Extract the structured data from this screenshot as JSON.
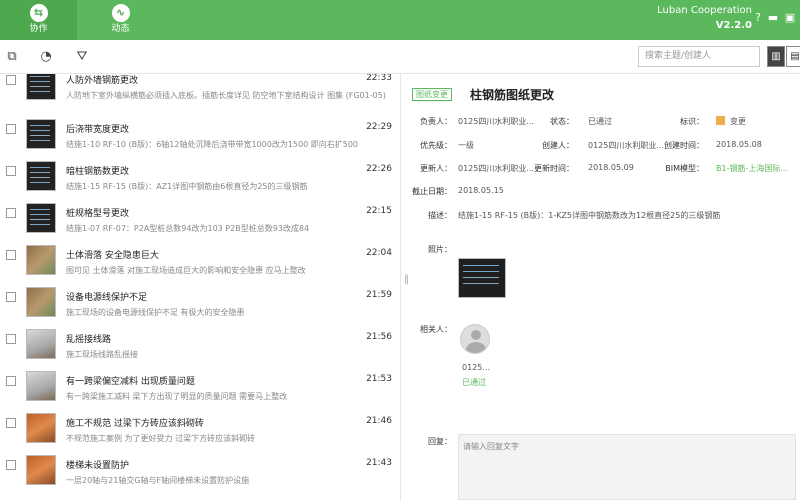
{
  "header": {
    "tabs": [
      {
        "label": "协作",
        "icon": "collab-icon"
      },
      {
        "label": "动态",
        "icon": "activity-icon"
      }
    ],
    "app_name": "Luban Cooperation",
    "version": "V2.2.0",
    "accent": "#5cb85c"
  },
  "window": {
    "help": "?",
    "minimize": "▬",
    "maximize": "▣",
    "close": "✕"
  },
  "toolbar": {
    "search_placeholder": "搜索主题/创建人",
    "new_icon": "new-icon",
    "stats_icon": "chart-icon",
    "filter_icon": "filter-icon"
  },
  "list": [
    {
      "title": "人防外墙钢筋更改",
      "desc": "人防地下室外墙纵横筋必须插入底板。插筋长度详见 防空地下室结构设计 图集 (FG01-05)...",
      "time": "22:33"
    },
    {
      "title": "后浇带宽度更改",
      "desc": "结施1-10 RF-10 (B版)：6轴12轴处沉降后浇带带宽1000改为1500 即向右扩500",
      "time": "22:29"
    },
    {
      "title": "暗柱钢筋数更改",
      "desc": "结施1-15 RF-15 (B版)：AZ1详图中钢筋由6根直径为25的三级钢筋",
      "time": "22:26"
    },
    {
      "title": "桩规格型号更改",
      "desc": "结施1-07 RF-07：P2A型桩总数94改为103 P2B型桩总数93改成84",
      "time": "22:15"
    },
    {
      "title": "土体滑落 安全隐患巨大",
      "desc": "图可见 土体滑落 对施工现场造成巨大的影响和安全隐患 应马上整改",
      "time": "22:04"
    },
    {
      "title": "设备电源线保护不足",
      "desc": "施工现场的设备电源线保护不足 有极大的安全隐患",
      "time": "21:59"
    },
    {
      "title": "乱摇接线路",
      "desc": "施工现场线路乱摇接",
      "time": "21:56"
    },
    {
      "title": "有一跨梁偏空减料 出现质量问题",
      "desc": "有一跨梁施工减料 梁下方出现了明显的质量问题 需要马上整改",
      "time": "21:53"
    },
    {
      "title": "施工不规范 过梁下方砖应该斜砌砖",
      "desc": "不规范施工案例 为了更好受力 过梁下方砖应该斜砌砖",
      "time": "21:46"
    },
    {
      "title": "楼梯未设置防护",
      "desc": "一层20轴与21轴交G轴与F轴间楼梯未设置防护设施",
      "time": "21:43"
    }
  ],
  "detail": {
    "tag": "图纸变更",
    "title": "柱钢筋图纸更改",
    "labels": {
      "owner": "负责人：",
      "status": "状态：",
      "mark": "标识：",
      "priority": "优先级：",
      "creator": "创建人：",
      "created": "创建时间：",
      "updater": "更新人：",
      "updated": "更新时间：",
      "bim": "BIM模型：",
      "deadline": "截止日期：",
      "description": "描述：",
      "photo": "照片：",
      "related": "相关人：",
      "reply": "回复："
    },
    "owner": "0125四川水利职业...",
    "status": "已通过",
    "mark": "变更",
    "priority": "一级",
    "creator": "0125四川水利职业...",
    "created": "2018.05.08",
    "updater": "0125四川水利职业...",
    "updated": "2018.05.09",
    "bim": "B1-钢筋-上海国际...",
    "deadline": "2018.05.15",
    "description": "结施1-15 RF-15 (B版)：1-KZ5详图中钢筋数改为12根直径25的三级钢筋",
    "related_name": "0125...",
    "related_status": "已通过",
    "reply_placeholder": "请输入回复文字"
  }
}
